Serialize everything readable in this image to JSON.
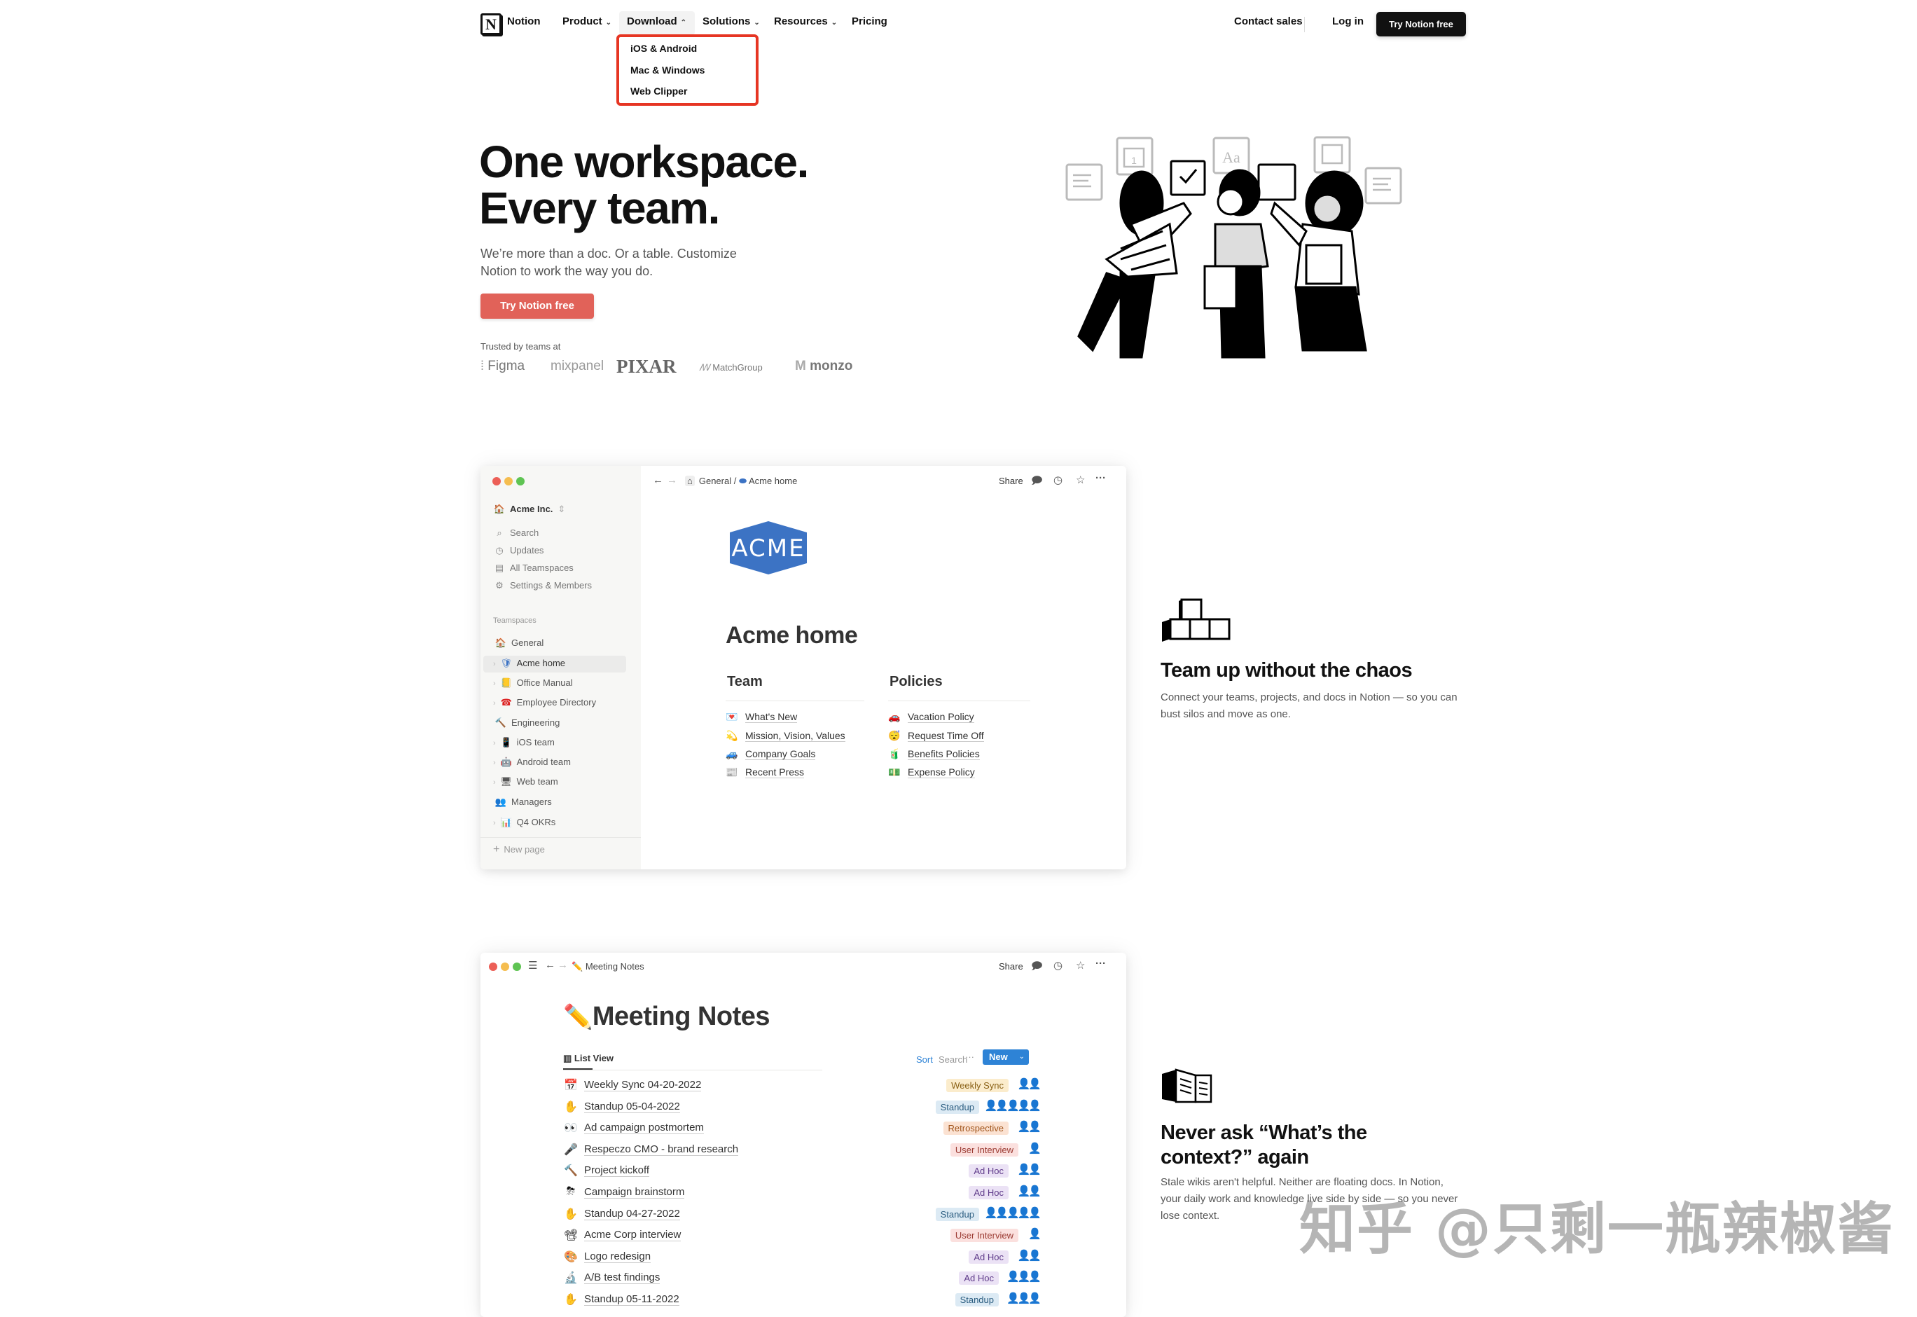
{
  "nav": {
    "brand": "Notion",
    "items": [
      {
        "label": "Product",
        "chevron": "chevron-down"
      },
      {
        "label": "Download",
        "chevron": "chevron-up"
      },
      {
        "label": "Solutions",
        "chevron": "chevron-down"
      },
      {
        "label": "Resources",
        "chevron": "chevron-down"
      },
      {
        "label": "Pricing"
      }
    ],
    "contact_sales": "Contact sales",
    "log_in": "Log in",
    "cta": "Try Notion free",
    "download_menu": [
      "iOS & Android",
      "Mac & Windows",
      "Web Clipper"
    ],
    "highlight_color": "#e63523"
  },
  "hero": {
    "title_line1": "One workspace.",
    "title_line2": "Every team.",
    "subtitle": "We’re more than a doc. Or a table. Customize Notion to work the way you do.",
    "cta": "Try Notion free",
    "cta_color": "#e16259",
    "trusted_label": "Trusted by teams at",
    "logos": [
      "Figma",
      "mixpanel",
      "PIXAR",
      "MatchGroup",
      "monzo"
    ],
    "illustration_cards": [
      "Aa",
      "1"
    ]
  },
  "acme_window": {
    "workspace": "Acme Inc.",
    "menu": [
      {
        "icon": "search-icon",
        "glyph": "⌕",
        "label": "Search"
      },
      {
        "icon": "clock-icon",
        "glyph": "◷",
        "label": "Updates"
      },
      {
        "icon": "building-icon",
        "glyph": "▤",
        "label": "All Teamspaces"
      },
      {
        "icon": "gear-icon",
        "glyph": "⚙",
        "label": "Settings & Members"
      }
    ],
    "teamspaces_label": "Teamspaces",
    "tree": [
      {
        "emoji": "🏠",
        "label": "General",
        "level": 0
      },
      {
        "emoji": "🛡",
        "label": "Acme home",
        "level": 1,
        "selected": true
      },
      {
        "emoji": "📒",
        "label": "Office Manual",
        "level": 1
      },
      {
        "emoji": "☎",
        "label": "Employee Directory",
        "level": 1
      },
      {
        "emoji": "🔨",
        "label": "Engineering",
        "level": 0
      },
      {
        "emoji": "📱",
        "label": "iOS team",
        "level": 1
      },
      {
        "emoji": "🤖",
        "label": "Android team",
        "level": 1
      },
      {
        "emoji": "🖥",
        "label": "Web team",
        "level": 1
      },
      {
        "emoji": "👥",
        "label": "Managers",
        "level": 0
      },
      {
        "emoji": "📊",
        "label": "Q4 OKRs",
        "level": 1
      }
    ],
    "new_page": "New page",
    "breadcrumb": [
      "General",
      "Acme home"
    ],
    "share": "Share",
    "logo_text": "ACME",
    "logo_color": "#3c73c4",
    "page_title": "Acme home",
    "team_heading": "Team",
    "team_links": [
      {
        "emoji": "💌",
        "label": "What's New"
      },
      {
        "emoji": "💫",
        "label": "Mission, Vision, Values"
      },
      {
        "emoji": "🚙",
        "label": "Company Goals"
      },
      {
        "emoji": "📰",
        "label": "Recent Press"
      }
    ],
    "policies_heading": "Policies",
    "policy_links": [
      {
        "emoji": "🚗",
        "label": "Vacation Policy"
      },
      {
        "emoji": "😴",
        "label": "Request Time Off"
      },
      {
        "emoji": "🧃",
        "label": "Benefits Policies"
      },
      {
        "emoji": "💵",
        "label": "Expense Policy"
      }
    ]
  },
  "feature1": {
    "title": "Team up without the chaos",
    "description": "Connect your teams, projects, and docs in Notion — so you can bust silos and move as one."
  },
  "meeting_window": {
    "page": "Meeting Notes",
    "share": "Share",
    "title": "Meeting Notes",
    "view": "List View",
    "sort": "Sort",
    "search": "Search",
    "new": "New",
    "rows": [
      {
        "emoji": "📅",
        "title": "Weekly Sync 04-20-2022",
        "tag": "Weekly Sync",
        "tag_bg": "#fbeccc",
        "tag_fg": "#8a6116",
        "avatars": "👤👤"
      },
      {
        "emoji": "✋",
        "title": "Standup 05-04-2022",
        "tag": "Standup",
        "tag_bg": "#dceaf4",
        "tag_fg": "#2b5d80",
        "avatars": "👤👤👤👤👤"
      },
      {
        "emoji": "👀",
        "title": "Ad campaign postmortem",
        "tag": "Retrospective",
        "tag_bg": "#fbe2d2",
        "tag_fg": "#a0541a",
        "avatars": "👤👤"
      },
      {
        "emoji": "🎤",
        "title": "Respeczo CMO - brand research",
        "tag": "User Interview",
        "tag_bg": "#fbe0de",
        "tag_fg": "#9b3a32",
        "avatars": "👤"
      },
      {
        "emoji": "🔨",
        "title": "Project kickoff",
        "tag": "Ad Hoc",
        "tag_bg": "#ebe2f5",
        "tag_fg": "#5f3b8a",
        "avatars": "👤👤"
      },
      {
        "emoji": "⛈",
        "title": "Campaign brainstorm",
        "tag": "Ad Hoc",
        "tag_bg": "#ebe2f5",
        "tag_fg": "#5f3b8a",
        "avatars": "👤👤"
      },
      {
        "emoji": "✋",
        "title": "Standup 04-27-2022",
        "tag": "Standup",
        "tag_bg": "#dceaf4",
        "tag_fg": "#2b5d80",
        "avatars": "👤👤👤👤👤"
      },
      {
        "emoji": "📽",
        "title": "Acme Corp interview",
        "tag": "User Interview",
        "tag_bg": "#fbe0de",
        "tag_fg": "#9b3a32",
        "avatars": "👤"
      },
      {
        "emoji": "🎨",
        "title": "Logo redesign",
        "tag": "Ad Hoc",
        "tag_bg": "#ebe2f5",
        "tag_fg": "#5f3b8a",
        "avatars": "👤👤"
      },
      {
        "emoji": "🔬",
        "title": "A/B test findings",
        "tag": "Ad Hoc",
        "tag_bg": "#ebe2f5",
        "tag_fg": "#5f3b8a",
        "avatars": "👤👤👤"
      },
      {
        "emoji": "✋",
        "title": "Standup 05-11-2022",
        "tag": "Standup",
        "tag_bg": "#dceaf4",
        "tag_fg": "#2b5d80",
        "avatars": "👤👤👤"
      }
    ]
  },
  "feature2": {
    "title": "Never ask “What’s the context?” again",
    "description": "Stale wikis aren't helpful. Neither are floating docs. In Notion, your daily work and knowledge live side by side — so you never lose context."
  },
  "watermark": "知乎 @只剩一瓶辣椒酱"
}
